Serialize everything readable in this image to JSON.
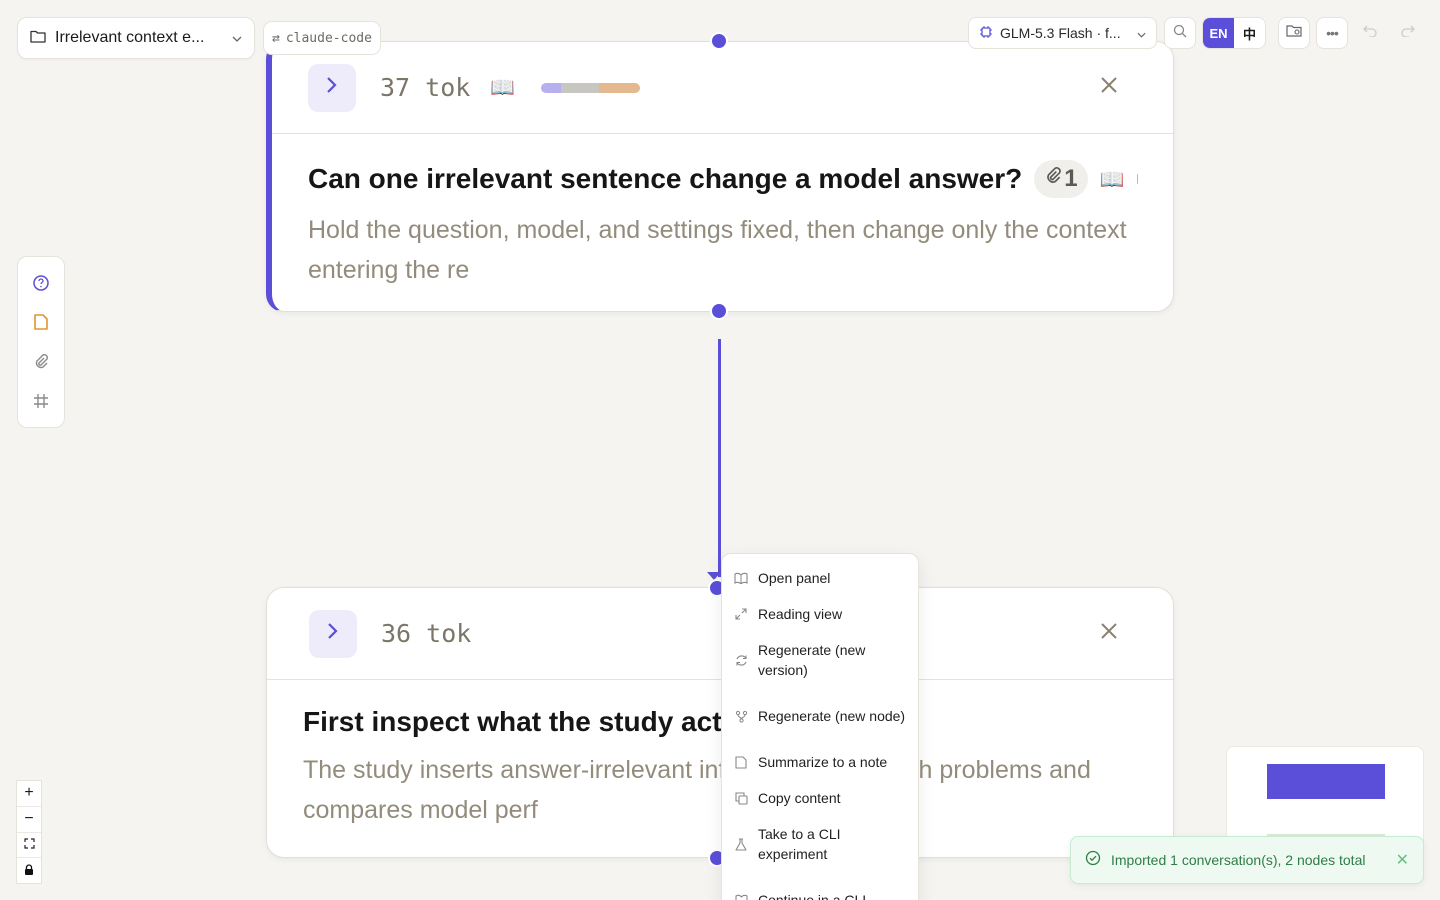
{
  "header": {
    "project_label": "Irrelevant context e...",
    "agent_label": "claude-code",
    "model_label": "GLM-5.3 Flash · f...",
    "lang_en": "EN",
    "lang_zh": "中"
  },
  "nodes": [
    {
      "tokens": "37 tok",
      "usage": [
        0.2,
        0.38,
        0.42
      ],
      "title": "Can one irrelevant sentence change a model answer?",
      "attachments": "1",
      "description": "Hold the question, model, and settings fixed, then change only the context entering the re"
    },
    {
      "tokens": "36 tok",
      "title": "First inspect what the study actually tested.",
      "description": "The study inserts answer-irrelevant information into math problems and compares model perf"
    }
  ],
  "context_menu": {
    "items": [
      {
        "label": "Open panel",
        "icon": "book-open-icon"
      },
      {
        "label": "Reading view",
        "icon": "expand-icon"
      },
      {
        "label": "Regenerate (new version)",
        "icon": "refresh-icon"
      },
      {
        "label": "Regenerate (new node)",
        "icon": "branch-icon"
      },
      {
        "label": "Summarize to a note",
        "icon": "note-icon"
      },
      {
        "label": "Copy content",
        "icon": "copy-icon"
      },
      {
        "label": "Take to a CLI experiment",
        "icon": "flask-icon"
      },
      {
        "label": "Continue in a CLI",
        "icon": "terminal-icon"
      }
    ]
  },
  "zoom": {
    "in": "+",
    "out": "−"
  },
  "toast": {
    "message": "Imported 1 conversation(s), 2 nodes total"
  },
  "colors": {
    "accent": "#5b4fd9",
    "success": "#2e7d46",
    "muted_text": "#938c7c"
  }
}
